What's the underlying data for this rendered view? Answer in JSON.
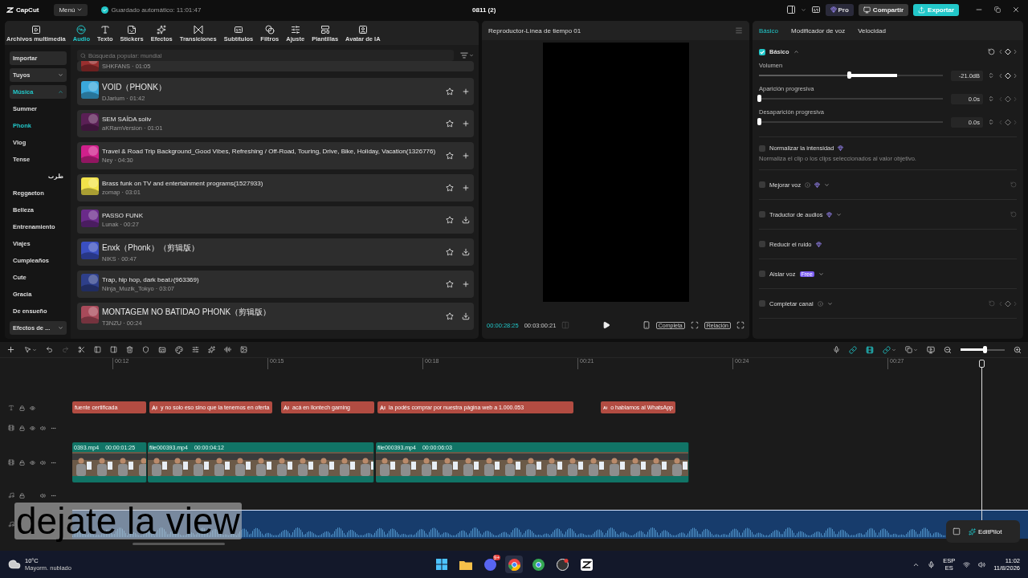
{
  "titlebar": {
    "logo": "CapCut",
    "menu": "Menú",
    "autosave": "Guardado automático: 11:01:47",
    "project": "0811 (2)",
    "pro": "Pro",
    "share": "Compartir",
    "export": "Exportar"
  },
  "tool_tabs": [
    {
      "label": "Archivos multimedia",
      "selected": false
    },
    {
      "label": "Audio",
      "selected": true
    },
    {
      "label": "Texto",
      "selected": false
    },
    {
      "label": "Stickers",
      "selected": false
    },
    {
      "label": "Efectos",
      "selected": false
    },
    {
      "label": "Transiciones",
      "selected": false
    },
    {
      "label": "Subtítulos",
      "selected": false
    },
    {
      "label": "Filtros",
      "selected": false
    },
    {
      "label": "Ajuste",
      "selected": false
    },
    {
      "label": "Plantillas",
      "selected": false
    },
    {
      "label": "Avatar de IA",
      "selected": false
    }
  ],
  "sidebar": [
    {
      "label": "Importar",
      "kind": "button"
    },
    {
      "label": "Tuyos",
      "kind": "group",
      "expanded": false,
      "selected": false
    },
    {
      "label": "Música",
      "kind": "group",
      "expanded": true,
      "selected": true
    },
    {
      "label": "Summer",
      "kind": "item",
      "selected": false
    },
    {
      "label": "Phonk",
      "kind": "item",
      "selected": true
    },
    {
      "label": "Vlog",
      "kind": "item",
      "selected": false
    },
    {
      "label": "Tense",
      "kind": "item",
      "selected": false
    },
    {
      "label": "طرب",
      "kind": "item",
      "selected": false
    },
    {
      "label": "Reggaeton",
      "kind": "item",
      "selected": false
    },
    {
      "label": "Belleza",
      "kind": "item",
      "selected": false
    },
    {
      "label": "Entrenamiento",
      "kind": "item",
      "selected": false
    },
    {
      "label": "Viajes",
      "kind": "item",
      "selected": false
    },
    {
      "label": "Cumpleaños",
      "kind": "item",
      "selected": false
    },
    {
      "label": "Cute",
      "kind": "item",
      "selected": false
    },
    {
      "label": "Gracia",
      "kind": "item",
      "selected": false
    },
    {
      "label": "De ensueño",
      "kind": "item",
      "selected": false
    },
    {
      "label": "Efectos de ...",
      "kind": "group",
      "expanded": false,
      "selected": false
    }
  ],
  "search": {
    "placeholder": "Búsqueda popular: mundial"
  },
  "tracks": [
    {
      "kind": "partial",
      "meta": "SHKFANS · 01:05",
      "color": "#9a2f2f"
    },
    {
      "kind": "full",
      "title": "VOID（PHONK）",
      "meta": "DJarium · 01:42",
      "downloaded": true,
      "color": "#3aa8dc"
    },
    {
      "kind": "full",
      "title": "SEM SAÍDA soliv",
      "meta": "aKRamVersion · 01:01",
      "downloaded": true,
      "color": "#5a1f55"
    },
    {
      "kind": "full",
      "title": "Travel & Road Trip Background_Good Vibes, Refreshing / Off-Road, Touring, Drive, Bike, Holiday, Vacation(1326776)",
      "meta": "Ney · 04:30",
      "downloaded": true,
      "color": "#d0208c"
    },
    {
      "kind": "full",
      "title": "Brass funk on TV and entertainment programs(1527933)",
      "meta": "zomap · 03:01",
      "downloaded": true,
      "color": "#f2e34a"
    },
    {
      "kind": "full",
      "title": "PASSO FUNK",
      "meta": "Lunak · 00:27",
      "downloaded": false,
      "color": "#6a2a8a"
    },
    {
      "kind": "full",
      "title": "Enxk（Phonk）（剪辑版）",
      "meta": "NIKS · 00:47",
      "downloaded": false,
      "color": "#3a4fc0"
    },
    {
      "kind": "full",
      "title": "Trap, hip hop, dark beat♪(963369)",
      "meta": "Ninja_Muzik_Tokyo · 03:07",
      "downloaded": true,
      "color": "#2e3f8a"
    },
    {
      "kind": "full",
      "title": "MONTAGEM  NO BATIDAO PHONK（剪辑版）",
      "meta": "T3NZU · 00:24",
      "downloaded": false,
      "color": "#a84a5a"
    }
  ],
  "player": {
    "title": "Reproductor-Línea de tiempo 01",
    "current": "00:00:28:25",
    "total": "00:03:00:21",
    "fit": "Completa",
    "ratio": "Relación"
  },
  "inspector": {
    "tabs": [
      {
        "label": "Básico",
        "selected": true
      },
      {
        "label": "Modificador de voz",
        "selected": false
      },
      {
        "label": "Velocidad",
        "selected": false
      }
    ],
    "basic": {
      "label": "Básico",
      "checked": true,
      "expanded": true
    },
    "sliders": [
      {
        "label": "Volumen",
        "level": 0.49,
        "value": "-21.0dB"
      },
      {
        "label": "Aparición progresiva",
        "level": 0,
        "value": "0.0s"
      },
      {
        "label": "Desaparición progresiva",
        "level": 0,
        "value": "0.0s"
      }
    ],
    "options": [
      {
        "label": "Normalizar la intensidad",
        "checked": false,
        "pro": true,
        "info": false,
        "dropdown": false,
        "reset": false,
        "keyframe": false,
        "description": "Normaliza el clip o los clips seleccionados al valor objetivo."
      },
      {
        "label": "Mejorar voz",
        "checked": false,
        "pro": true,
        "info": true,
        "dropdown": true,
        "reset": true,
        "keyframe": false
      },
      {
        "label": "Traductor de audios",
        "checked": false,
        "pro": true,
        "info": false,
        "dropdown": true,
        "reset": true,
        "keyframe": false
      },
      {
        "label": "Reducir el ruido",
        "checked": false,
        "pro": true,
        "info": false,
        "dropdown": false,
        "reset": false,
        "keyframe": false
      },
      {
        "label": "Aislar voz",
        "checked": false,
        "pro": false,
        "free": "Free",
        "info": false,
        "dropdown": true,
        "reset": false,
        "keyframe": false
      },
      {
        "label": "Completar canal",
        "checked": false,
        "pro": false,
        "info": true,
        "dropdown": true,
        "reset": true,
        "keyframe": true
      }
    ]
  },
  "timeline": {
    "ruler": [
      "00:12",
      "00:15",
      "00:18",
      "00:21",
      "00:24",
      "00:27"
    ],
    "zoom": {
      "level": 0.55
    },
    "captions": [
      {
        "text": "fuente certificada",
        "icon": false
      },
      {
        "text": "y no solo eso sino que la tenemos en oferta",
        "icon": true
      },
      {
        "text": "acá en llontech gaming",
        "icon": true
      },
      {
        "text": "la podés comprar por nuestra página web a 1.000.053",
        "icon": true
      },
      {
        "text": "o hablamos al WhatsApp",
        "icon": true
      }
    ],
    "video_clips": [
      {
        "name": "0393.mp4",
        "duration": "00:00:01:25"
      },
      {
        "name": "file000393.mp4",
        "duration": "00:00:04:12"
      },
      {
        "name": "file000393.mp4",
        "duration": "00:00:06:03"
      }
    ],
    "overlay_caption": "dejate la view",
    "editpilot": "EditPilot"
  },
  "taskbar": {
    "temp": "10°C",
    "weather": "Mayorm. nublado",
    "badge": "9+",
    "lang": "ESP",
    "layout": "ES",
    "time": "11:02",
    "date": "11/8/2026"
  }
}
